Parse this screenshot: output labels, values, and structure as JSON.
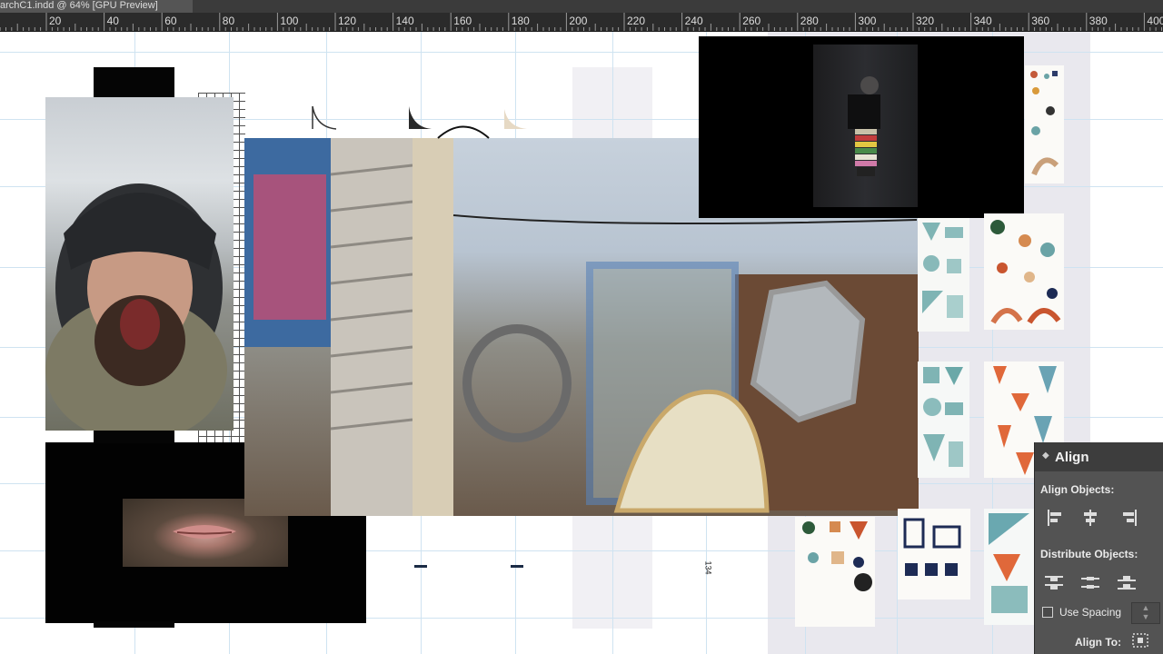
{
  "window": {
    "document_tab_title": "archC1.indd @ 64% [GPU Preview]"
  },
  "ruler": {
    "labels": [
      "20",
      "40",
      "60",
      "80",
      "100",
      "120",
      "140",
      "160",
      "180",
      "200",
      "220",
      "240",
      "260",
      "280",
      "300",
      "320",
      "340",
      "360",
      "380",
      "400"
    ]
  },
  "canvas": {
    "page_number_marker": "134"
  },
  "align_panel": {
    "tab_label": "Align",
    "align_objects_heading": "Align Objects:",
    "distribute_objects_heading": "Distribute Objects:",
    "use_spacing_label": "Use Spacing",
    "use_spacing_checked": false,
    "align_to_label": "Align To:"
  },
  "colors": {
    "ruler_bg": "#2b2b2b",
    "panel_bg": "#535353",
    "guide_blue": "#cfe3f1",
    "pasteboard_gray": "#e7e6ec"
  }
}
